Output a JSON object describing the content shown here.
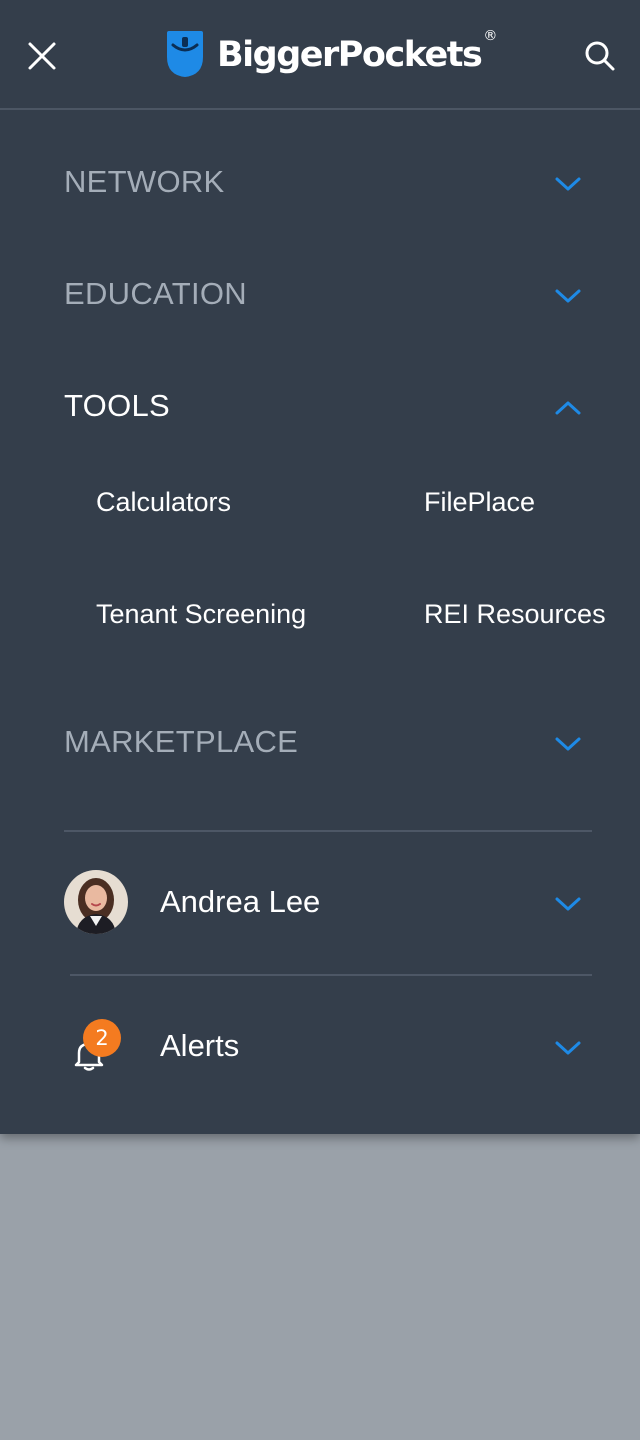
{
  "header": {
    "brand": "BiggerPockets",
    "brand_mark": "®",
    "close_icon": "close-icon",
    "search_icon": "search-icon",
    "brand_color": "#1e8ae6"
  },
  "menu": {
    "sections": [
      {
        "label": "NETWORK",
        "expanded": false
      },
      {
        "label": "EDUCATION",
        "expanded": false
      },
      {
        "label": "TOOLS",
        "expanded": true
      },
      {
        "label": "MARKETPLACE",
        "expanded": false
      }
    ],
    "tools_items": [
      "Calculators",
      "FilePlace",
      "Tenant Screening",
      "REI Resources"
    ]
  },
  "user": {
    "name": "Andrea Lee",
    "avatar_icon": "avatar"
  },
  "alerts": {
    "label": "Alerts",
    "count": "2",
    "icon": "bell-icon",
    "badge_color": "#f47b20"
  },
  "colors": {
    "drawer_bg": "#343e4b",
    "accent": "#1e8ae6",
    "muted_text": "#a4adb8",
    "overlay": "#9aa1a9"
  }
}
